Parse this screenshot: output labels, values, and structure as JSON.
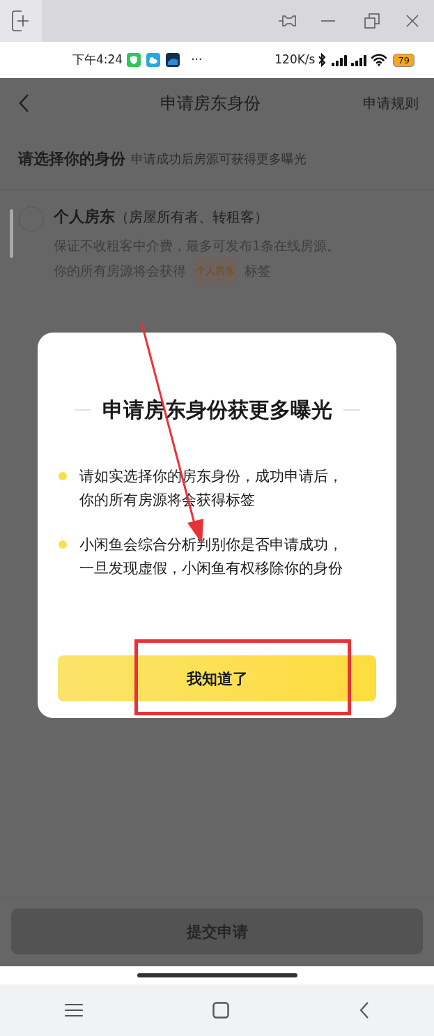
{
  "status_bar": {
    "time": "下午4:24",
    "more": "···",
    "speed": "120K/s",
    "battery": "79"
  },
  "header": {
    "title": "申请房东身份",
    "action": "申请规则"
  },
  "section": {
    "title": "请选择你的身份",
    "hint": "申请成功后房源可获得更多曝光"
  },
  "options": [
    {
      "title": "个人房东",
      "subtitle": "（房屋所有者、转租客）",
      "description": "保证不收租客中介费，最多可发布1条在线房源。",
      "tag_before": "你的所有房源将会获得",
      "tag": "个人房东",
      "tag_after": "标签",
      "selected": false
    }
  ],
  "dialog": {
    "title": "申请房东身份获更多曝光",
    "bullets": [
      "请如实选择你的房东身份，成功申请后，你的所有房源将会获得标签",
      "小闲鱼会综合分析判别你是否申请成功，一旦发现虚假，小闲鱼有权移除你的身份"
    ],
    "button": "我知道了"
  },
  "submit": {
    "label": "提交申请",
    "disabled": true
  }
}
